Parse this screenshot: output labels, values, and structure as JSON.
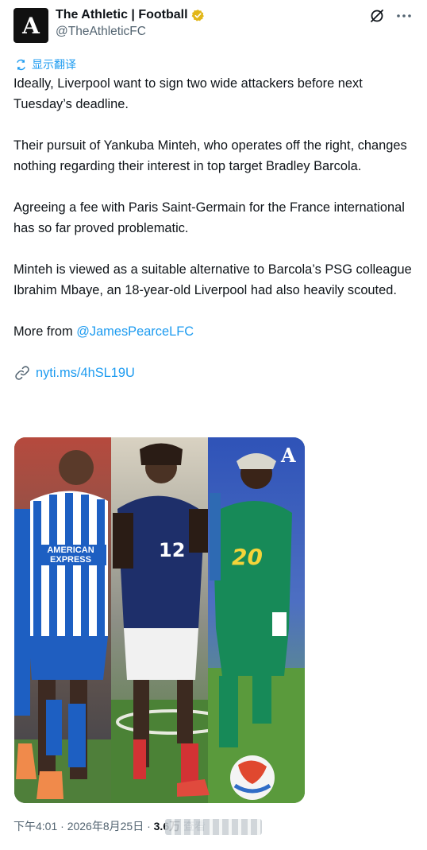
{
  "account": {
    "display_name": "The Athletic | Football",
    "handle": "@TheAthleticFC",
    "avatar_letter": "A"
  },
  "translate_label": "显示翻译",
  "tweet": {
    "p1": "Ideally, Liverpool want to sign two wide attackers before next Tuesday’s deadline.",
    "p2": "Their pursuit of Yankuba Minteh, who operates off the right, changes nothing regarding their interest in top target Bradley Barcola.",
    "p3": "Agreeing a fee with Paris Saint-Germain for the France international has so far proved problematic.",
    "p4": "Minteh is viewed as a suitable alternative to Barcola’s PSG colleague Ibrahim Mbaye, an 18-year-old Liverpool had also heavily scouted.",
    "more_from": "More from ",
    "mention": "@JamesPearceLFC",
    "url": "nyti.ms/4hSL19U"
  },
  "media": {
    "shirt_left": "AMERICAN EXPRESS",
    "number_mid": "12",
    "number_right": "20",
    "watermark": "A"
  },
  "footer": {
    "time_date": "下午4:01 · 2026年8月25日 · ",
    "views": "3.6万",
    "views_label": " 查看"
  },
  "icons": [
    "verified-badge-icon",
    "grok-icon",
    "more-icon",
    "translate-icon",
    "link-icon"
  ],
  "colors": {
    "link": "#1d9bf0",
    "verified": "#e2b719",
    "muted": "#536471"
  }
}
